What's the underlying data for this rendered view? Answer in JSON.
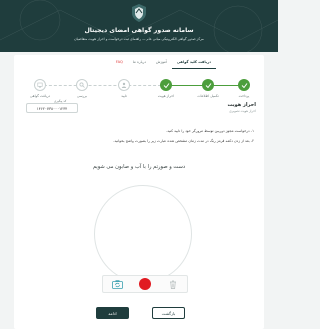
{
  "header": {
    "title": "سامانه صدور گواهی امضای دیجیتال",
    "subtitle": "مرکز صدور گواهی الکترونیکی میانی عام — راهنمای ثبت درخواست و احراز هویت متقاضیان"
  },
  "tabs": [
    {
      "label": "دریافت کلید گواهی",
      "active": true
    },
    {
      "label": "آموزش",
      "active": false
    },
    {
      "label": "درباره ما",
      "active": false
    },
    {
      "label": "FAQ",
      "active": false
    }
  ],
  "steps": [
    {
      "label": "پرداخت",
      "state": "done"
    },
    {
      "label": "تکمیل اطلاعات",
      "state": "done"
    },
    {
      "label": "احراز هویت",
      "state": "done"
    },
    {
      "label": "تایید",
      "state": "todo"
    },
    {
      "label": "بررسی",
      "state": "todo"
    },
    {
      "label": "دریافت گواهی",
      "state": "todo"
    }
  ],
  "identity": {
    "title": "احراز هویت",
    "subtitle": "احراز هویت تصویری",
    "tracking_label": "کد پیگیری",
    "tracking_code": "۱۴۶۲۰۷۳۸۰۰۰۱۲۳۴"
  },
  "instructions": [
    "۱- درخواست مجوز دوربین توسط مرورگر خود را تایید کنید.",
    "۲- بعد از زدن دکمه قرمز رنگ در مدت زمان مشخص شده عبارت زیر را بصورت واضح بخوانید."
  ],
  "capture_phrase": "دست و صورتم را با آب و صابون می شویم",
  "controls": {
    "camera_icon": "camera-switch-icon",
    "record_icon": "record-icon",
    "trash_icon": "trash-icon"
  },
  "buttons": {
    "next": "ادامه",
    "back": "بازگشت"
  },
  "colors": {
    "brand": "#1f3d3d",
    "done": "#4c9e3c",
    "record": "#e11b22"
  }
}
